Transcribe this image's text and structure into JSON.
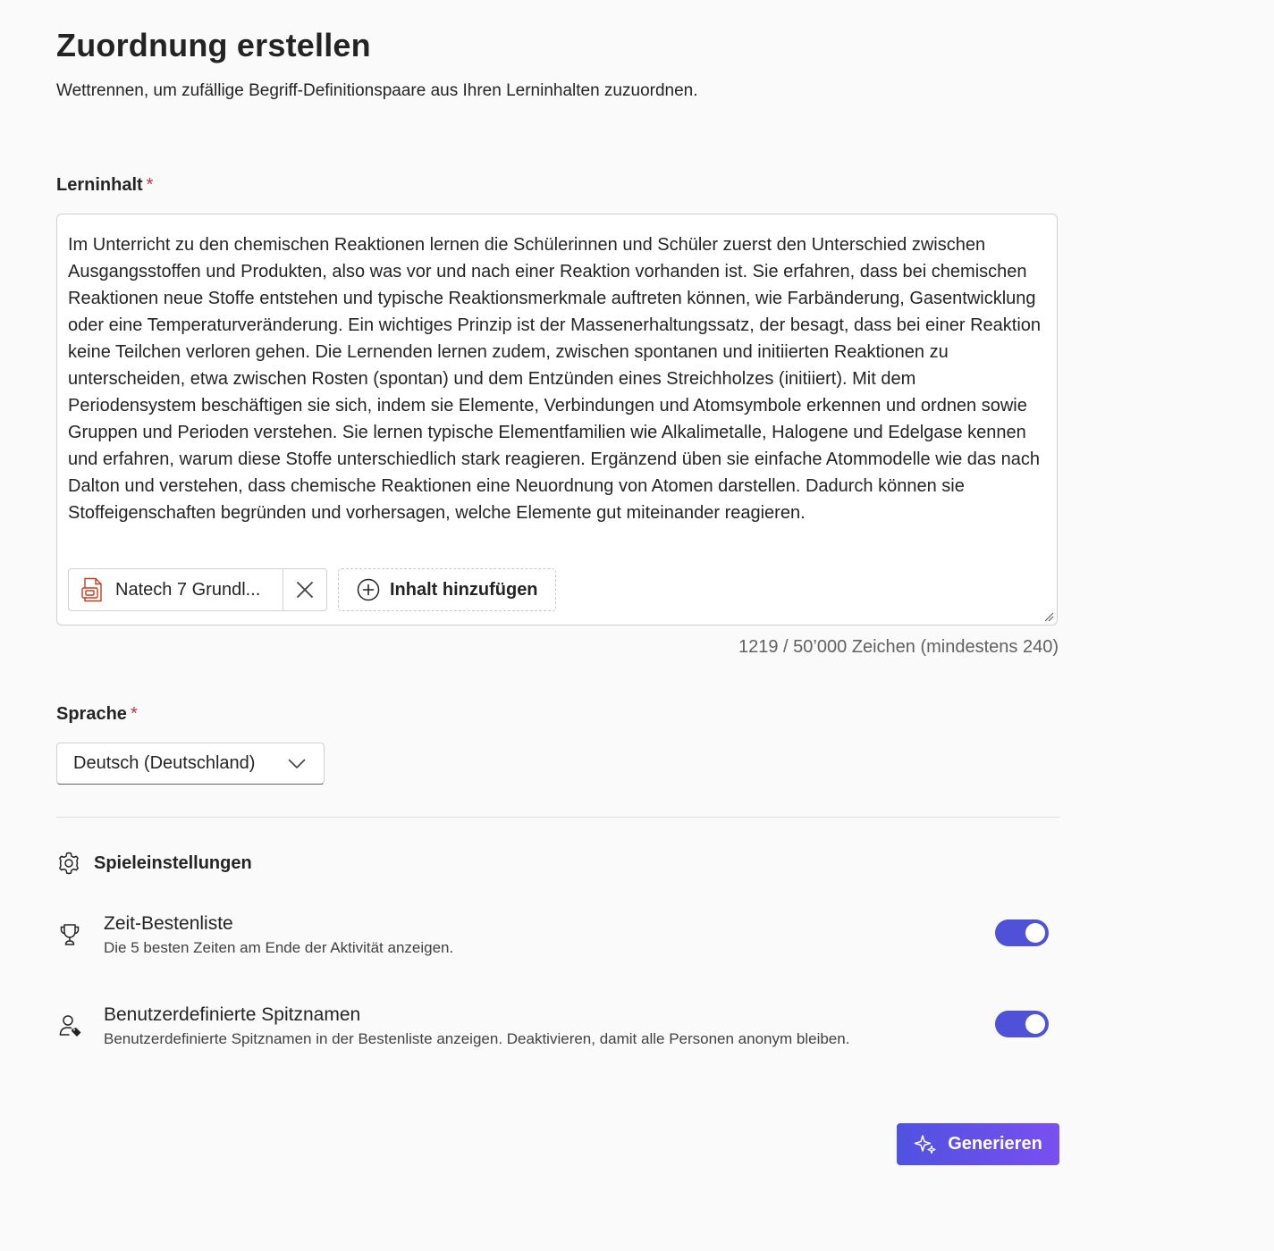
{
  "header": {
    "title": "Zuordnung erstellen",
    "subtitle": "Wettrennen, um zufällige Begriff-Definitionspaare aus Ihren Lerninhalten zuzuordnen."
  },
  "content_field": {
    "label": "Lerninhalt",
    "required_marker": "*",
    "text": "Im Unterricht zu den chemischen Reaktionen lernen die Schülerinnen und Schüler zuerst den Unterschied zwischen Ausgangsstoffen und Produkten, also was vor und nach einer Reaktion vorhanden ist. Sie erfahren, dass bei chemischen Reaktionen neue Stoffe entstehen und typische Reaktionsmerkmale auftreten können, wie Farbänderung, Gasentwicklung oder eine Temperaturveränderung. Ein wichtiges Prinzip ist der Massenerhaltungssatz, der besagt, dass bei einer Reaktion keine Teilchen verloren gehen. Die Lernenden lernen zudem, zwischen spontanen und initiierten Reaktionen zu unterscheiden, etwa zwischen Rosten (spontan) und dem Entzünden eines Streichholzes (initiiert). Mit dem Periodensystem beschäftigen sie sich, indem sie Elemente, Verbindungen und Atomsymbole erkennen und ordnen sowie Gruppen und Perioden verstehen. Sie lernen typische Elementfamilien wie Alkalimetalle, Halogene und Edelgase kennen und erfahren, warum diese Stoffe unterschiedlich stark reagieren. Ergänzend üben sie einfache Atommodelle wie das nach Dalton und verstehen, dass chemische Reaktionen eine Neuordnung von Atomen darstellen. Dadurch können sie Stoffeigenschaften begründen und vorhersagen, welche Elemente gut miteinander reagieren.",
    "attachment": {
      "name": "Natech 7 Grundl...",
      "icon": "powerpoint-file-icon"
    },
    "add_content_label": "Inhalt hinzufügen",
    "char_counter": "1219 / 50’000 Zeichen (mindestens 240)"
  },
  "language_field": {
    "label": "Sprache",
    "required_marker": "*",
    "selected": "Deutsch (Deutschland)"
  },
  "settings": {
    "title": "Spieleinstellungen",
    "items": [
      {
        "title": "Zeit-Bestenliste",
        "description": "Die 5 besten Zeiten am Ende der Aktivität anzeigen.",
        "icon": "trophy-icon",
        "enabled": true
      },
      {
        "title": "Benutzerdefinierte Spitznamen",
        "description": "Benutzerdefinierte Spitznamen in der Bestenliste anzeigen. Deaktivieren, damit alle Personen anonym bleiben.",
        "icon": "person-tag-icon",
        "enabled": true
      }
    ]
  },
  "actions": {
    "generate_label": "Generieren"
  },
  "colors": {
    "accent": "#4f52d8",
    "required": "#c4314b",
    "background": "#fafafa"
  }
}
